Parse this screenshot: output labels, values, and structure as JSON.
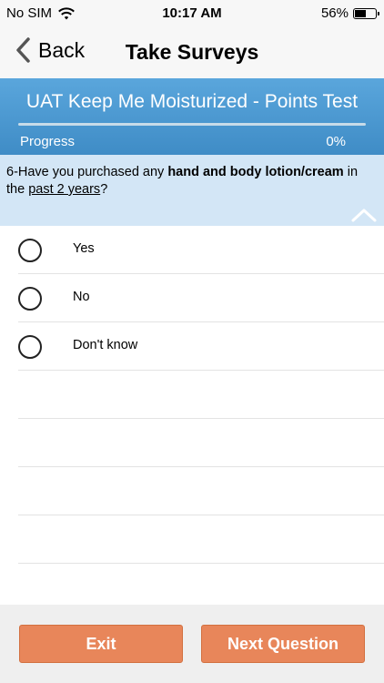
{
  "status_bar": {
    "carrier": "No SIM",
    "time": "10:17 AM",
    "battery_percent": "56%",
    "battery_level": 0.56
  },
  "nav": {
    "back_label": "Back",
    "title": "Take Surveys"
  },
  "survey": {
    "title": "UAT Keep Me Moisturized - Points Test",
    "progress_label": "Progress",
    "progress_value": "0%",
    "progress_fraction": 0
  },
  "question": {
    "prefix": "6-Have you purchased any ",
    "bold": "hand and body lotion/cream",
    "middle": " in the ",
    "underline": "past 2 years",
    "suffix": "?"
  },
  "answers": [
    {
      "label": "Yes"
    },
    {
      "label": "No"
    },
    {
      "label": "Don't know"
    }
  ],
  "footer": {
    "exit_label": "Exit",
    "next_label": "Next Question"
  },
  "colors": {
    "header_blue": "#4a98d0",
    "question_bg": "#d3e6f6",
    "button_orange": "#e8865a"
  }
}
